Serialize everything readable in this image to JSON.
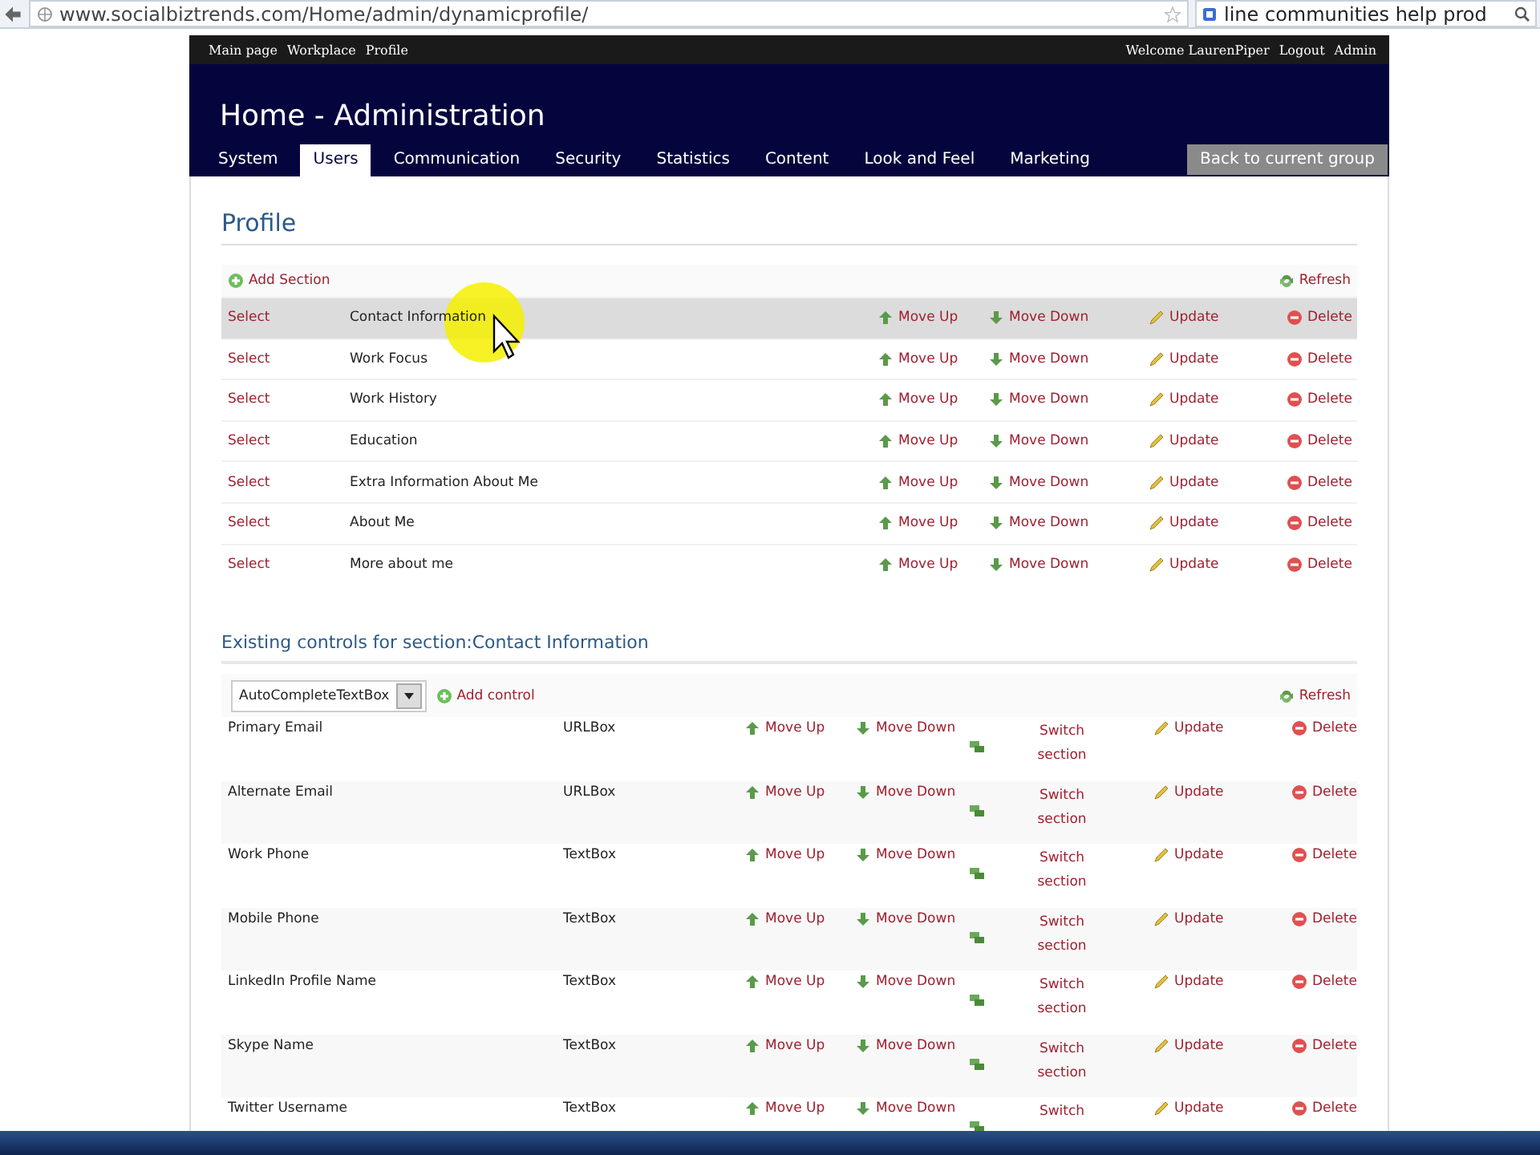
{
  "browser": {
    "url": "www.socialbiztrends.com/Home/admin/dynamicprofile/",
    "search": "line communities help prod"
  },
  "topbar": {
    "left_links": [
      "Main page",
      "Workplace",
      "Profile"
    ],
    "welcome": "Welcome LaurenPiper",
    "right_links": [
      "Logout",
      "Admin"
    ]
  },
  "header": {
    "title": "Home - Administration",
    "tabs": [
      {
        "label": "System",
        "selected": false
      },
      {
        "label": "Users",
        "selected": true
      },
      {
        "label": "Communication",
        "selected": false
      },
      {
        "label": "Security",
        "selected": false
      },
      {
        "label": "Statistics",
        "selected": false
      },
      {
        "label": "Content",
        "selected": false
      },
      {
        "label": "Look and Feel",
        "selected": false
      },
      {
        "label": "Marketing",
        "selected": false
      }
    ],
    "back_button": "Back to current group"
  },
  "profile": {
    "heading": "Profile",
    "add_section": "Add Section",
    "refresh": "Refresh",
    "sections": [
      {
        "select": "Select",
        "name": "Contact Information",
        "move_up": "Move Up",
        "move_down": "Move Down",
        "update": "Update",
        "delete": "Delete",
        "selected": true
      },
      {
        "select": "Select",
        "name": "Work Focus",
        "move_up": "Move Up",
        "move_down": "Move Down",
        "update": "Update",
        "delete": "Delete",
        "selected": false
      },
      {
        "select": "Select",
        "name": "Work History",
        "move_up": "Move Up",
        "move_down": "Move Down",
        "update": "Update",
        "delete": "Delete",
        "selected": false
      },
      {
        "select": "Select",
        "name": "Education",
        "move_up": "Move Up",
        "move_down": "Move Down",
        "update": "Update",
        "delete": "Delete",
        "selected": false
      },
      {
        "select": "Select",
        "name": "Extra Information About Me",
        "move_up": "Move Up",
        "move_down": "Move Down",
        "update": "Update",
        "delete": "Delete",
        "selected": false
      },
      {
        "select": "Select",
        "name": "About Me",
        "move_up": "Move Up",
        "move_down": "Move Down",
        "update": "Update",
        "delete": "Delete",
        "selected": false
      },
      {
        "select": "Select",
        "name": "More about me",
        "move_up": "Move Up",
        "move_down": "Move Down",
        "update": "Update",
        "delete": "Delete",
        "selected": false
      }
    ]
  },
  "controls": {
    "heading": "Existing controls for section:Contact Information",
    "dropdown": "AutoCompleteTextBox",
    "add_control": "Add control",
    "refresh": "Refresh",
    "rows": [
      {
        "name": "Primary Email",
        "type": "URLBox",
        "move_up": "Move Up",
        "move_down": "Move Down",
        "switch": "Switch section",
        "update": "Update",
        "delete": "Delete"
      },
      {
        "name": "Alternate Email",
        "type": "URLBox",
        "move_up": "Move Up",
        "move_down": "Move Down",
        "switch": "Switch section",
        "update": "Update",
        "delete": "Delete"
      },
      {
        "name": "Work Phone",
        "type": "TextBox",
        "move_up": "Move Up",
        "move_down": "Move Down",
        "switch": "Switch section",
        "update": "Update",
        "delete": "Delete"
      },
      {
        "name": "Mobile Phone",
        "type": "TextBox",
        "move_up": "Move Up",
        "move_down": "Move Down",
        "switch": "Switch section",
        "update": "Update",
        "delete": "Delete"
      },
      {
        "name": "LinkedIn Profile Name",
        "type": "TextBox",
        "move_up": "Move Up",
        "move_down": "Move Down",
        "switch": "Switch section",
        "update": "Update",
        "delete": "Delete"
      },
      {
        "name": "Skype Name",
        "type": "TextBox",
        "move_up": "Move Up",
        "move_down": "Move Down",
        "switch": "Switch section",
        "update": "Update",
        "delete": "Delete"
      },
      {
        "name": "Twitter Username",
        "type": "TextBox",
        "move_up": "Move Up",
        "move_down": "Move Down",
        "switch": "Switch",
        "update": "Update",
        "delete": "Delete"
      }
    ]
  }
}
